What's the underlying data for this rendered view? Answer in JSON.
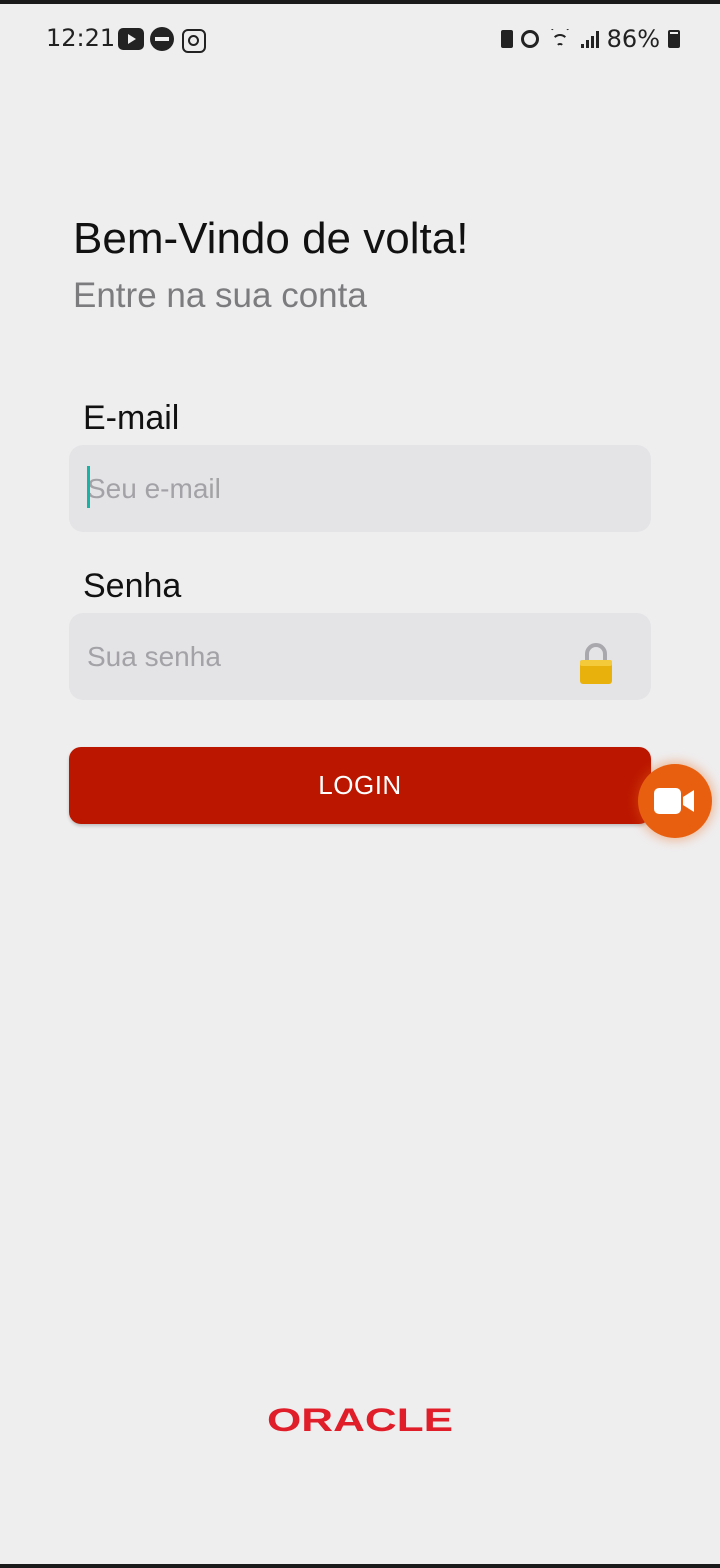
{
  "status_bar": {
    "time": "12:21",
    "battery_percent": "86%",
    "left_icons": [
      "youtube-icon",
      "do-not-disturb-icon",
      "instagram-icon"
    ],
    "right_icons": [
      "battery-saver-icon",
      "alarm-icon",
      "wifi-icon",
      "signal-icon",
      "battery-icon"
    ]
  },
  "header": {
    "title": "Bem-Vindo de volta!",
    "subtitle": "Entre na sua conta"
  },
  "form": {
    "email": {
      "label": "E-mail",
      "placeholder": "Seu e-mail",
      "value": ""
    },
    "password": {
      "label": "Senha",
      "placeholder": "Sua senha",
      "value": "",
      "icon": "lock-icon"
    },
    "login_label": "LOGIN"
  },
  "floating_button": {
    "icon": "video-camera-icon"
  },
  "footer": {
    "logo_text": "ORACLE"
  },
  "colors": {
    "background": "#efeeef",
    "input_background": "#e4e3e6",
    "login_button": "#bb1700",
    "fab": "#e8600f",
    "logo": "#e01e2a",
    "cursor": "#17b3a6"
  }
}
